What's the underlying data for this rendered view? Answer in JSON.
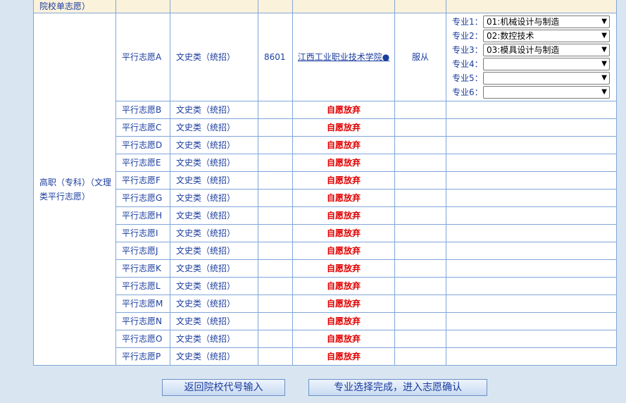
{
  "top_row": {
    "category_text": "院校单志愿）"
  },
  "category": "高职（专科）（文理类平行志愿）",
  "first_choice": {
    "name": "平行志愿A",
    "type": "文史类（统招）",
    "code": "8601",
    "school": "江西工业职业技术学院●",
    "obey": "服从",
    "majors": [
      {
        "label": "专业1：",
        "value": "01:机械设计与制造"
      },
      {
        "label": "专业2：",
        "value": "02:数控技术"
      },
      {
        "label": "专业3：",
        "value": "03:模具设计与制造"
      },
      {
        "label": "专业4：",
        "value": ""
      },
      {
        "label": "专业5：",
        "value": ""
      },
      {
        "label": "专业6：",
        "value": ""
      }
    ]
  },
  "rows": [
    {
      "name": "平行志愿B",
      "type": "文史类（统招）",
      "status": "自愿放弃"
    },
    {
      "name": "平行志愿C",
      "type": "文史类（统招）",
      "status": "自愿放弃"
    },
    {
      "name": "平行志愿D",
      "type": "文史类（统招）",
      "status": "自愿放弃"
    },
    {
      "name": "平行志愿E",
      "type": "文史类（统招）",
      "status": "自愿放弃"
    },
    {
      "name": "平行志愿F",
      "type": "文史类（统招）",
      "status": "自愿放弃"
    },
    {
      "name": "平行志愿G",
      "type": "文史类（统招）",
      "status": "自愿放弃"
    },
    {
      "name": "平行志愿H",
      "type": "文史类（统招）",
      "status": "自愿放弃"
    },
    {
      "name": "平行志愿I",
      "type": "文史类（统招）",
      "status": "自愿放弃"
    },
    {
      "name": "平行志愿J",
      "type": "文史类（统招）",
      "status": "自愿放弃"
    },
    {
      "name": "平行志愿K",
      "type": "文史类（统招）",
      "status": "自愿放弃"
    },
    {
      "name": "平行志愿L",
      "type": "文史类（统招）",
      "status": "自愿放弃"
    },
    {
      "name": "平行志愿M",
      "type": "文史类（统招）",
      "status": "自愿放弃"
    },
    {
      "name": "平行志愿N",
      "type": "文史类（统招）",
      "status": "自愿放弃"
    },
    {
      "name": "平行志愿O",
      "type": "文史类（统招）",
      "status": "自愿放弃"
    },
    {
      "name": "平行志愿P",
      "type": "文史类（统招）",
      "status": "自愿放弃"
    }
  ],
  "buttons": {
    "back": "返回院校代号输入",
    "confirm": "专业选择完成，进入志愿确认"
  }
}
